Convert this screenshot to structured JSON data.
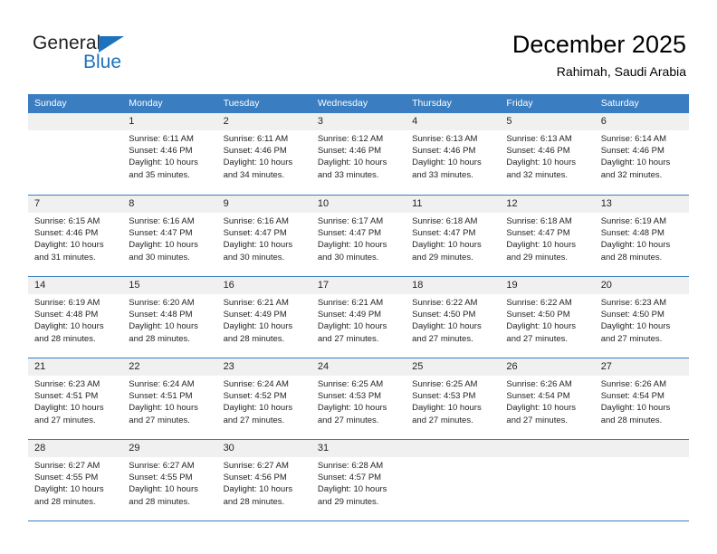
{
  "brand": {
    "name_part1": "General",
    "name_part2": "Blue",
    "triangle_icon": "triangle-icon",
    "accent_color": "#1c72bd"
  },
  "header": {
    "title": "December 2025",
    "subtitle": "Rahimah, Saudi Arabia"
  },
  "calendar": {
    "header_color": "#3a7dc0",
    "daynum_band_color": "#f0f0f0",
    "weekdays": [
      "Sunday",
      "Monday",
      "Tuesday",
      "Wednesday",
      "Thursday",
      "Friday",
      "Saturday"
    ],
    "weeks": [
      [
        {
          "day": "",
          "lines": []
        },
        {
          "day": "1",
          "lines": [
            "Sunrise: 6:11 AM",
            "Sunset: 4:46 PM",
            "Daylight: 10 hours",
            "and 35 minutes."
          ]
        },
        {
          "day": "2",
          "lines": [
            "Sunrise: 6:11 AM",
            "Sunset: 4:46 PM",
            "Daylight: 10 hours",
            "and 34 minutes."
          ]
        },
        {
          "day": "3",
          "lines": [
            "Sunrise: 6:12 AM",
            "Sunset: 4:46 PM",
            "Daylight: 10 hours",
            "and 33 minutes."
          ]
        },
        {
          "day": "4",
          "lines": [
            "Sunrise: 6:13 AM",
            "Sunset: 4:46 PM",
            "Daylight: 10 hours",
            "and 33 minutes."
          ]
        },
        {
          "day": "5",
          "lines": [
            "Sunrise: 6:13 AM",
            "Sunset: 4:46 PM",
            "Daylight: 10 hours",
            "and 32 minutes."
          ]
        },
        {
          "day": "6",
          "lines": [
            "Sunrise: 6:14 AM",
            "Sunset: 4:46 PM",
            "Daylight: 10 hours",
            "and 32 minutes."
          ]
        }
      ],
      [
        {
          "day": "7",
          "lines": [
            "Sunrise: 6:15 AM",
            "Sunset: 4:46 PM",
            "Daylight: 10 hours",
            "and 31 minutes."
          ]
        },
        {
          "day": "8",
          "lines": [
            "Sunrise: 6:16 AM",
            "Sunset: 4:47 PM",
            "Daylight: 10 hours",
            "and 30 minutes."
          ]
        },
        {
          "day": "9",
          "lines": [
            "Sunrise: 6:16 AM",
            "Sunset: 4:47 PM",
            "Daylight: 10 hours",
            "and 30 minutes."
          ]
        },
        {
          "day": "10",
          "lines": [
            "Sunrise: 6:17 AM",
            "Sunset: 4:47 PM",
            "Daylight: 10 hours",
            "and 30 minutes."
          ]
        },
        {
          "day": "11",
          "lines": [
            "Sunrise: 6:18 AM",
            "Sunset: 4:47 PM",
            "Daylight: 10 hours",
            "and 29 minutes."
          ]
        },
        {
          "day": "12",
          "lines": [
            "Sunrise: 6:18 AM",
            "Sunset: 4:47 PM",
            "Daylight: 10 hours",
            "and 29 minutes."
          ]
        },
        {
          "day": "13",
          "lines": [
            "Sunrise: 6:19 AM",
            "Sunset: 4:48 PM",
            "Daylight: 10 hours",
            "and 28 minutes."
          ]
        }
      ],
      [
        {
          "day": "14",
          "lines": [
            "Sunrise: 6:19 AM",
            "Sunset: 4:48 PM",
            "Daylight: 10 hours",
            "and 28 minutes."
          ]
        },
        {
          "day": "15",
          "lines": [
            "Sunrise: 6:20 AM",
            "Sunset: 4:48 PM",
            "Daylight: 10 hours",
            "and 28 minutes."
          ]
        },
        {
          "day": "16",
          "lines": [
            "Sunrise: 6:21 AM",
            "Sunset: 4:49 PM",
            "Daylight: 10 hours",
            "and 28 minutes."
          ]
        },
        {
          "day": "17",
          "lines": [
            "Sunrise: 6:21 AM",
            "Sunset: 4:49 PM",
            "Daylight: 10 hours",
            "and 27 minutes."
          ]
        },
        {
          "day": "18",
          "lines": [
            "Sunrise: 6:22 AM",
            "Sunset: 4:50 PM",
            "Daylight: 10 hours",
            "and 27 minutes."
          ]
        },
        {
          "day": "19",
          "lines": [
            "Sunrise: 6:22 AM",
            "Sunset: 4:50 PM",
            "Daylight: 10 hours",
            "and 27 minutes."
          ]
        },
        {
          "day": "20",
          "lines": [
            "Sunrise: 6:23 AM",
            "Sunset: 4:50 PM",
            "Daylight: 10 hours",
            "and 27 minutes."
          ]
        }
      ],
      [
        {
          "day": "21",
          "lines": [
            "Sunrise: 6:23 AM",
            "Sunset: 4:51 PM",
            "Daylight: 10 hours",
            "and 27 minutes."
          ]
        },
        {
          "day": "22",
          "lines": [
            "Sunrise: 6:24 AM",
            "Sunset: 4:51 PM",
            "Daylight: 10 hours",
            "and 27 minutes."
          ]
        },
        {
          "day": "23",
          "lines": [
            "Sunrise: 6:24 AM",
            "Sunset: 4:52 PM",
            "Daylight: 10 hours",
            "and 27 minutes."
          ]
        },
        {
          "day": "24",
          "lines": [
            "Sunrise: 6:25 AM",
            "Sunset: 4:53 PM",
            "Daylight: 10 hours",
            "and 27 minutes."
          ]
        },
        {
          "day": "25",
          "lines": [
            "Sunrise: 6:25 AM",
            "Sunset: 4:53 PM",
            "Daylight: 10 hours",
            "and 27 minutes."
          ]
        },
        {
          "day": "26",
          "lines": [
            "Sunrise: 6:26 AM",
            "Sunset: 4:54 PM",
            "Daylight: 10 hours",
            "and 27 minutes."
          ]
        },
        {
          "day": "27",
          "lines": [
            "Sunrise: 6:26 AM",
            "Sunset: 4:54 PM",
            "Daylight: 10 hours",
            "and 28 minutes."
          ]
        }
      ],
      [
        {
          "day": "28",
          "lines": [
            "Sunrise: 6:27 AM",
            "Sunset: 4:55 PM",
            "Daylight: 10 hours",
            "and 28 minutes."
          ]
        },
        {
          "day": "29",
          "lines": [
            "Sunrise: 6:27 AM",
            "Sunset: 4:55 PM",
            "Daylight: 10 hours",
            "and 28 minutes."
          ]
        },
        {
          "day": "30",
          "lines": [
            "Sunrise: 6:27 AM",
            "Sunset: 4:56 PM",
            "Daylight: 10 hours",
            "and 28 minutes."
          ]
        },
        {
          "day": "31",
          "lines": [
            "Sunrise: 6:28 AM",
            "Sunset: 4:57 PM",
            "Daylight: 10 hours",
            "and 29 minutes."
          ]
        },
        {
          "day": "",
          "lines": []
        },
        {
          "day": "",
          "lines": []
        },
        {
          "day": "",
          "lines": []
        }
      ]
    ]
  }
}
